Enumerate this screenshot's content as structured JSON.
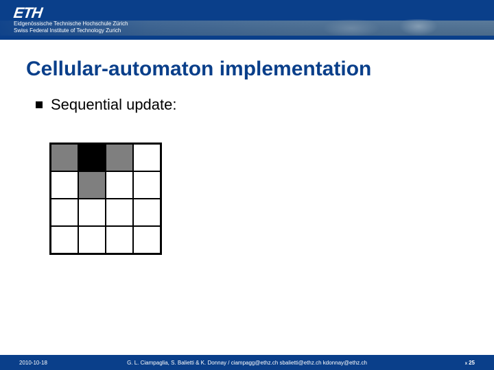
{
  "header": {
    "logo_text": "ETH",
    "sub1": "Eidgenössische Technische Hochschule Zürich",
    "sub2": "Swiss Federal Institute of Technology Zurich"
  },
  "content": {
    "title": "Cellular-automaton implementation",
    "bullet": "Sequential update:"
  },
  "chart_data": {
    "type": "heatmap",
    "title": "4×4 cellular automaton grid (0=white, 1=gray, 2=black)",
    "rows": 4,
    "cols": 4,
    "grid": [
      [
        1,
        2,
        1,
        0
      ],
      [
        0,
        1,
        0,
        0
      ],
      [
        0,
        0,
        0,
        0
      ],
      [
        0,
        0,
        0,
        0
      ]
    ],
    "legend": {
      "0": "white",
      "1": "gray",
      "2": "black"
    }
  },
  "footer": {
    "date": "2010-10-18",
    "credit": "G. L. Ciampaglia, S. Balietti & K. Donnay / ciampagg@ethz.ch sbalietti@ethz.ch kdonnay@ethz.ch",
    "page_x": "x",
    "page_num": "25"
  }
}
